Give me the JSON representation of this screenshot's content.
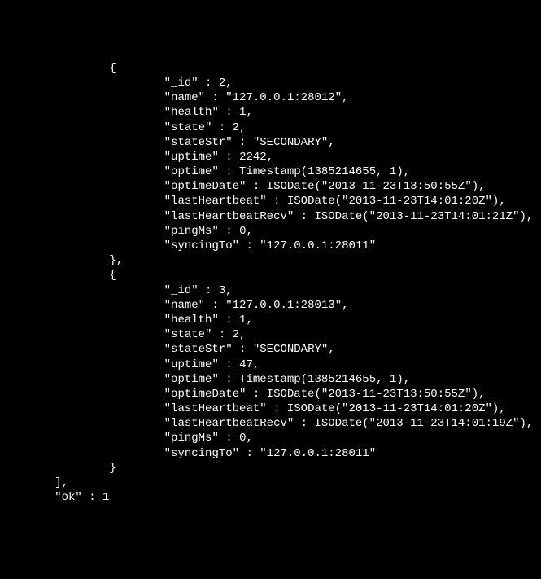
{
  "members": [
    {
      "_id": 2,
      "name": "127.0.0.1:28012",
      "health": 1,
      "state": 2,
      "stateStr": "SECONDARY",
      "uptime": 2242,
      "optime_ts": 1385214655,
      "optime_inc": 1,
      "optimeDate": "2013-11-23T13:50:55Z",
      "lastHeartbeat": "2013-11-23T14:01:20Z",
      "lastHeartbeatRecv": "2013-11-23T14:01:21Z",
      "pingMs": 0,
      "syncingTo": "127.0.0.1:28011"
    },
    {
      "_id": 3,
      "name": "127.0.0.1:28013",
      "health": 1,
      "state": 2,
      "stateStr": "SECONDARY",
      "uptime": 47,
      "optime_ts": 1385214655,
      "optime_inc": 1,
      "optimeDate": "2013-11-23T13:50:55Z",
      "lastHeartbeat": "2013-11-23T14:01:20Z",
      "lastHeartbeatRecv": "2013-11-23T14:01:19Z",
      "pingMs": 0,
      "syncingTo": "127.0.0.1:28011"
    }
  ],
  "ok": 1,
  "tokens": {
    "open_brace": "{",
    "close_brace_comma": "},",
    "close_brace": "}",
    "close_bracket_comma": "],",
    "id_key": "\"_id\" : ",
    "name_key": "\"name\" : \"",
    "health_key": "\"health\" : ",
    "state_key": "\"state\" : ",
    "stateStr_key": "\"stateStr\" : \"",
    "uptime_key": "\"uptime\" : ",
    "optime_key": "\"optime\" : Timestamp(",
    "optime_mid": ", ",
    "optime_end": "),",
    "optimeDate_key": "\"optimeDate\" : ISODate(\"",
    "iso_end": "\"),",
    "lastHeartbeat_key": "\"lastHeartbeat\" : ISODate(\"",
    "lastHeartbeatRecv_key": "\"lastHeartbeatRecv\" : ISODate(\"",
    "pingMs_key": "\"pingMs\" : ",
    "syncingTo_key": "\"syncingTo\" : \"",
    "str_end_comma": "\",",
    "str_end": "\"",
    "comma": ",",
    "ok_key": "\"ok\" : "
  },
  "indent": {
    "i2": "                ",
    "i3": "                        ",
    "i1": "        "
  }
}
